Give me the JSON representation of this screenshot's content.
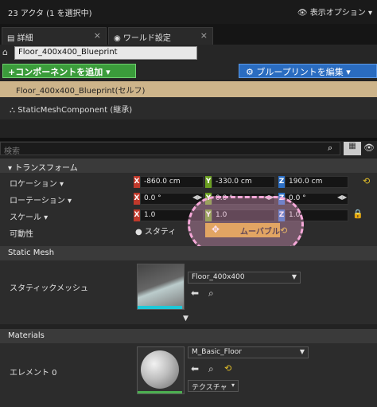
{
  "header": {
    "title": "23 アクタ (1 を選択中)",
    "view_options": "表示オプション"
  },
  "tabs": [
    {
      "label": "詳細"
    },
    {
      "label": "ワールド設定"
    }
  ],
  "name_field": {
    "value": "Floor_400x400_Blueprint"
  },
  "buttons": {
    "add_component": "+コンポーネントを追加",
    "blueprint": "ブループリントを編集"
  },
  "components": {
    "self": "Floor_400x400_Blueprint(セルフ)",
    "static_mesh": "StaticMeshComponent (継承)"
  },
  "search": {
    "placeholder": "検索"
  },
  "transform": {
    "section": "トランスフォーム",
    "location": {
      "label": "ロケーション",
      "x": "-860.0 cm",
      "y": "-330.0 cm",
      "z": "190.0 cm"
    },
    "rotation": {
      "label": "ローテーション",
      "x": "0.0 °",
      "y": "0.0 °",
      "z": "0.0 °"
    },
    "scale": {
      "label": "スケール",
      "x": "1.0",
      "y": "1.0",
      "z": "1.0"
    },
    "mobility": {
      "label": "可動性",
      "static": "スタティ",
      "movable": "ムーバブル"
    }
  },
  "static_mesh": {
    "section": "Static Mesh",
    "label": "スタティックメッシュ",
    "asset": "Floor_400x400"
  },
  "materials": {
    "section": "Materials",
    "label": "エレメント 0",
    "asset": "M_Basic_Floor",
    "texture_btn": "テクスチャ"
  },
  "colors": {
    "axis_x": "#c0392b",
    "axis_y": "#6a9f20",
    "axis_z": "#2c6fc4",
    "accent": "#e6c229"
  }
}
